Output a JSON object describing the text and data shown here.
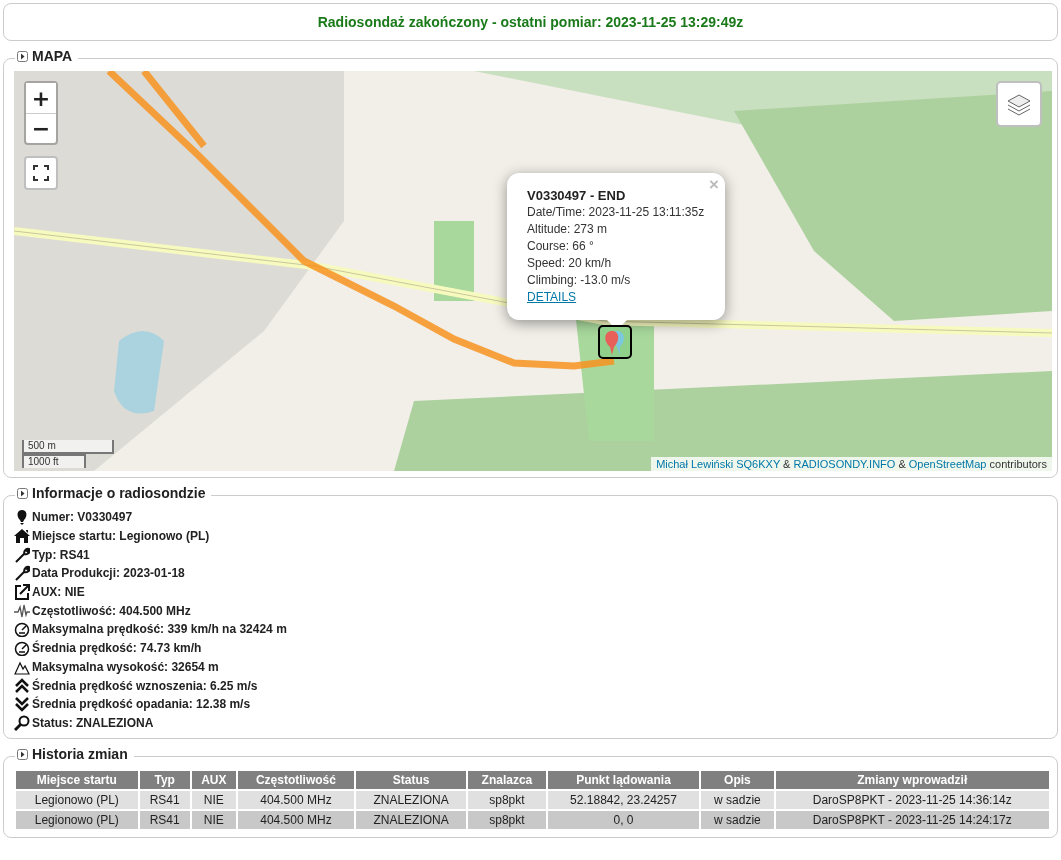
{
  "status_banner": "Radiosondaż zakończony - ostatni pomiar: 2023-11-25 13:29:49z",
  "map_section": {
    "title": "MAPA",
    "zoom_in": "+",
    "zoom_out": "−",
    "popup": {
      "title": "V0330497 - END",
      "lines": [
        "Date/Time: 2023-11-25 13:11:35z",
        "Altitude: 273 m",
        "Course: 66 °",
        "Speed: 20 km/h",
        "Climbing: -13.0 m/s"
      ],
      "link": "DETAILS",
      "close": "×"
    },
    "scale": [
      "500 m",
      "1000 ft"
    ],
    "attribution": [
      {
        "text": "Michał Lewiński SQ6KXY",
        "link": true
      },
      {
        "text": " & ",
        "link": false
      },
      {
        "text": "RADIOSONDY.INFO",
        "link": true
      },
      {
        "text": " & ",
        "link": false
      },
      {
        "text": "OpenStreetMap",
        "link": true
      },
      {
        "text": " contributors",
        "link": false
      }
    ]
  },
  "info_section": {
    "title": "Informacje o radiosondzie",
    "items": [
      "Numer: V0330497",
      "Miejsce startu: Legionowo (PL)",
      "Typ: RS41",
      "Data Produkcji: 2023-01-18",
      "AUX: NIE",
      "Częstotliwość: 404.500 MHz",
      "Maksymalna prędkość: 339 km/h na 32424 m",
      "Średnia prędkość: 74.73 km/h",
      "Maksymalna wysokość: 32654 m",
      "Średnia prędkość wznoszenia: 6.25 m/s",
      "Średnia prędkość opadania: 12.38 m/s",
      "Status: ZNALEZIONA"
    ]
  },
  "history_section": {
    "title": "Historia zmian",
    "columns": [
      "Miejsce startu",
      "Typ",
      "AUX",
      "Częstotliwość",
      "Status",
      "Znalazca",
      "Punkt lądowania",
      "Opis",
      "Zmiany wprowadził"
    ],
    "rows": [
      [
        "Legionowo (PL)",
        "RS41",
        "NIE",
        "404.500 MHz",
        "ZNALEZIONA",
        "sp8pkt",
        "52.18842, 23.24257",
        "w sadzie",
        "DaroSP8PKT - 2023-11-25 14:36:14z"
      ],
      [
        "Legionowo (PL)",
        "RS41",
        "NIE",
        "404.500 MHz",
        "ZNALEZIONA",
        "sp8pkt",
        "0, 0",
        "w sadzie",
        "DaroSP8PKT - 2023-11-25 14:24:17z"
      ]
    ]
  }
}
